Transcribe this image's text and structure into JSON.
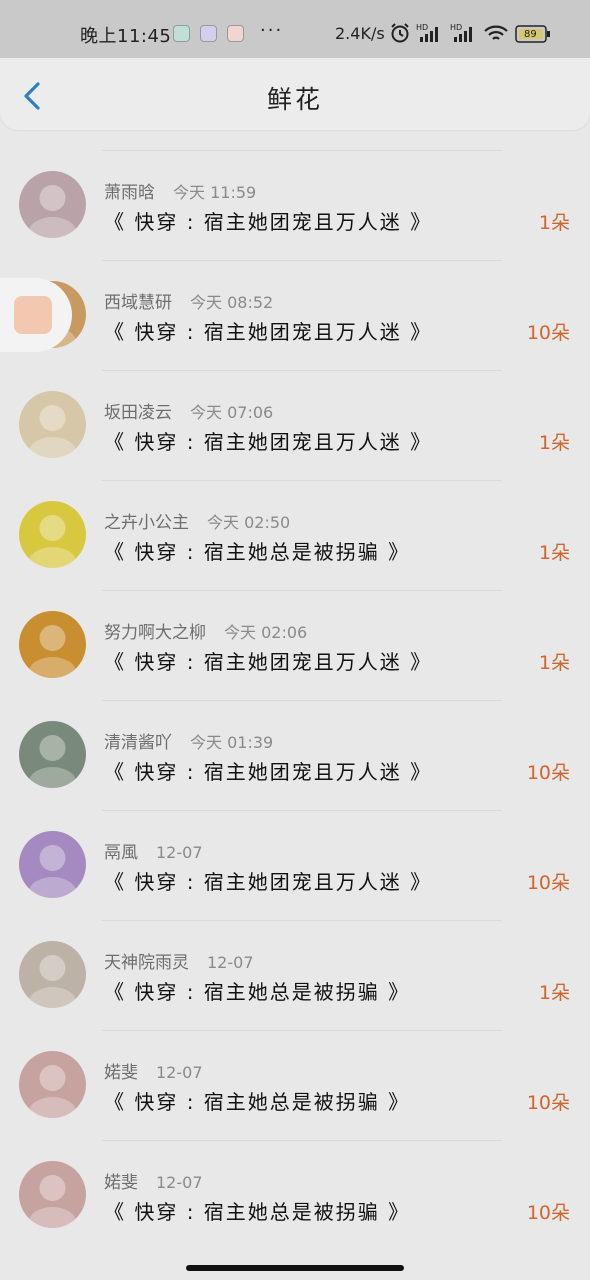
{
  "status_bar": {
    "time": "晚上11:45",
    "more": "···",
    "net_speed": "2.4K/s",
    "battery": "89"
  },
  "header": {
    "title": "鲜花"
  },
  "items": [
    {
      "name": "萧雨晗",
      "time": "今天 11:59",
      "book": "《 快穿 : 宿主她团宠且万人迷 》",
      "count": "1朵",
      "avatar_color": "#b9a3a8"
    },
    {
      "name": "西域慧研",
      "time": "今天 08:52",
      "book": "《 快穿 : 宿主她团宠且万人迷 》",
      "count": "10朵",
      "avatar_color": "#c89a5f"
    },
    {
      "name": "坂田凌云",
      "time": "今天 07:06",
      "book": "《 快穿 : 宿主她团宠且万人迷 》",
      "count": "1朵",
      "avatar_color": "#d6c7a8"
    },
    {
      "name": "之卉小公主",
      "time": "今天 02:50",
      "book": "《 快穿 : 宿主她总是被拐骗 》",
      "count": "1朵",
      "avatar_color": "#d8c840"
    },
    {
      "name": "努力啊大之柳",
      "time": "今天 02:06",
      "book": "《 快穿 : 宿主她团宠且万人迷 》",
      "count": "1朵",
      "avatar_color": "#c98e30"
    },
    {
      "name": "清清酱吖",
      "time": "今天 01:39",
      "book": "《 快穿 : 宿主她团宠且万人迷 》",
      "count": "10朵",
      "avatar_color": "#7a8a7a"
    },
    {
      "name": "鬲風",
      "time": "12-07",
      "book": "《 快穿 : 宿主她团宠且万人迷 》",
      "count": "10朵",
      "avatar_color": "#a48ac0"
    },
    {
      "name": "天神院雨灵",
      "time": "12-07",
      "book": "《 快穿 : 宿主她总是被拐骗 》",
      "count": "1朵",
      "avatar_color": "#bdb2a6"
    },
    {
      "name": "婼斐",
      "time": "12-07",
      "book": "《 快穿 : 宿主她总是被拐骗 》",
      "count": "10朵",
      "avatar_color": "#c7a3a0"
    },
    {
      "name": "婼斐",
      "time": "12-07",
      "book": "《 快穿 : 宿主她总是被拐骗 》",
      "count": "10朵",
      "avatar_color": "#c7a3a0"
    }
  ],
  "colors": {
    "accent": "#2a7fc7",
    "count": "#d2652d"
  }
}
